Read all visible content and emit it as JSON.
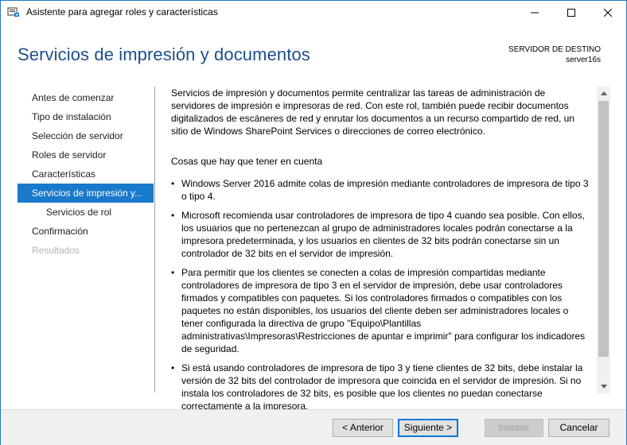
{
  "window": {
    "title": "Asistente para agregar roles y características",
    "controls": {
      "minimize_icon": "minimize-icon",
      "maximize_icon": "maximize-icon",
      "close_icon": "close-icon"
    }
  },
  "header": {
    "page_title": "Servicios de impresión y documentos",
    "destination_label": "SERVIDOR DE DESTINO",
    "destination_server": "server16s"
  },
  "sidebar": {
    "items": [
      {
        "label": "Antes de comenzar",
        "state": "normal"
      },
      {
        "label": "Tipo de instalación",
        "state": "normal"
      },
      {
        "label": "Selección de servidor",
        "state": "normal"
      },
      {
        "label": "Roles de servidor",
        "state": "normal"
      },
      {
        "label": "Características",
        "state": "normal"
      },
      {
        "label": "Servicios de impresión y...",
        "state": "active"
      },
      {
        "label": "Servicios de rol",
        "state": "sub"
      },
      {
        "label": "Confirmación",
        "state": "normal"
      },
      {
        "label": "Resultados",
        "state": "disabled"
      }
    ]
  },
  "content": {
    "intro": "Servicios de impresión y documentos permite centralizar las tareas de administración de servidores de impresión e impresoras de red. Con este rol, también puede recibir documentos digitalizados de escáneres de red y enrutar los documentos a un recurso compartido de red, un sitio de Windows SharePoint Services o direcciones de correo electrónico.",
    "subheading": "Cosas que hay que tener en cuenta",
    "bullets": [
      "Windows Server 2016 admite colas de impresión mediante controladores de impresora de tipo 3 o tipo 4.",
      "Microsoft recomienda usar controladores de impresora de tipo 4 cuando sea posible. Con ellos, los usuarios que no pertenezcan al grupo de administradores locales podrán conectarse a la impresora predeterminada, y los usuarios en clientes de 32 bits podrán conectarse sin un controlador de 32 bits en el servidor de impresión.",
      "Para permitir que los clientes se conecten a colas de impresión compartidas mediante controladores de impresora de tipo 3 en el servidor de impresión, debe usar controladores firmados y compatibles con paquetes. Si los controladores firmados o compatibles con los paquetes no están disponibles, los usuarios del cliente deben ser administradores locales o tener configurada la directiva de grupo \"Equipo\\Plantillas administrativas\\Impresoras\\Restricciones de apuntar e imprimir\" para configurar los indicadores de seguridad.",
      "Si está usando controladores de impresora de tipo 3 y tiene clientes de 32 bits, debe instalar la versión de 32 bits del controlador de impresora que coincida en el servidor de impresión. Si no instala los controladores de 32 bits, es posible que los clientes no puedan conectarse correctamente a la impresora."
    ]
  },
  "footer": {
    "back_label": "< Anterior",
    "next_label": "Siguiente >",
    "install_label": "Instalar",
    "cancel_label": "Cancelar"
  },
  "colors": {
    "title_blue": "#1e4e8c",
    "active_item": "#1979ca",
    "window_border": "#2b78c2"
  }
}
